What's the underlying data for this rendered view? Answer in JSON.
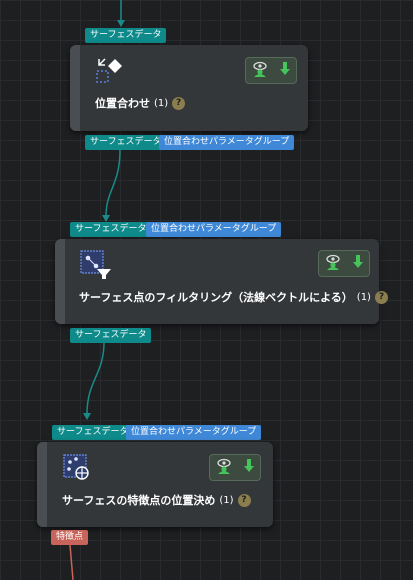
{
  "tags": {
    "surface_data": "サーフェスデータ",
    "align_params": "位置合わせパラメータグループ",
    "feature_point": "特徴点"
  },
  "nodes": [
    {
      "title": "位置合わせ",
      "count": "(1)",
      "help": "?"
    },
    {
      "title": "サーフェス点のフィルタリング（法線ベクトルによる）",
      "count": "(1)",
      "help": "?"
    },
    {
      "title": "サーフェスの特徴点の位置決め",
      "count": "(1)",
      "help": "?"
    }
  ],
  "colors": {
    "teal_port": "#0e8a8a",
    "blue_port": "#3f88d8",
    "red_port": "#c8645a",
    "wire_teal": "#1a8a8a",
    "wire_red": "#c8645a"
  },
  "icons": [
    "align-icon",
    "filter-icon",
    "feature-point-icon",
    "visibility-icon",
    "download-icon",
    "help-icon"
  ]
}
